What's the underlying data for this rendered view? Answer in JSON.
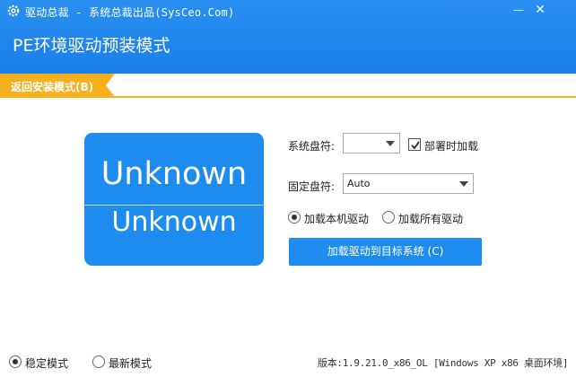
{
  "titlebar": {
    "app_title": "驱动总裁 - 系统总裁出品(SysCeo.Com)",
    "minimize_label": "—",
    "close_label": "✕"
  },
  "header": {
    "mode_title": "PE环境驱动预装模式"
  },
  "tab": {
    "back_label": "返回安装模式(B)"
  },
  "drive_card": {
    "line1": "Unknown",
    "line2": "Unknown"
  },
  "form": {
    "system_drive_label": "系统盘符:",
    "system_drive_value": "",
    "load_temp_label": "部署时加载",
    "load_temp_checked": true,
    "fixed_drive_label": "固定盘符:",
    "fixed_drive_value": "Auto",
    "radio_local_label": "加载本机驱动",
    "radio_all_label": "加载所有驱动",
    "radio_selected": "local"
  },
  "action": {
    "load_button_label": "加载驱动到目标系统 (C)"
  },
  "footer": {
    "stable_mode_label": "稳定模式",
    "latest_mode_label": "最新模式",
    "selected_mode": "stable",
    "version_text": "版本:1.9.21.0_x86_OL [Windows XP x86 桌面环境]"
  },
  "colors": {
    "header_blue": "#1a7fe8",
    "accent_blue": "#1e8cef",
    "tab_orange": "#f6b01e"
  },
  "icons": {
    "app_icon": "gear-icon",
    "check_icon": "checkmark-icon"
  }
}
